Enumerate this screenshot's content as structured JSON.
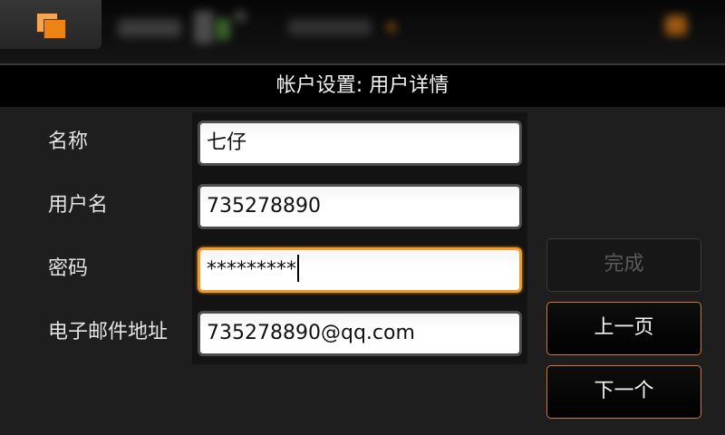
{
  "colors": {
    "accent": "#f08a1c",
    "focused_border": "#f39a2c",
    "dialog_background": "#1e1e1e",
    "title_background": "#000000"
  },
  "statusbar": {
    "switcher_icon": "task-switcher-icon"
  },
  "dialog": {
    "title": "帐户设置: 用户详情",
    "fields": [
      {
        "label": "名称",
        "value": "七仔",
        "focused": false
      },
      {
        "label": "用户名",
        "value": "735278890",
        "focused": false
      },
      {
        "label": "密码",
        "value": "*********",
        "focused": true
      },
      {
        "label": "电子邮件地址",
        "value": "735278890@qq.com",
        "focused": false
      }
    ],
    "buttons": [
      {
        "label": "完成",
        "enabled": false
      },
      {
        "label": "上一页",
        "enabled": true
      },
      {
        "label": "下一个",
        "enabled": true
      }
    ]
  }
}
